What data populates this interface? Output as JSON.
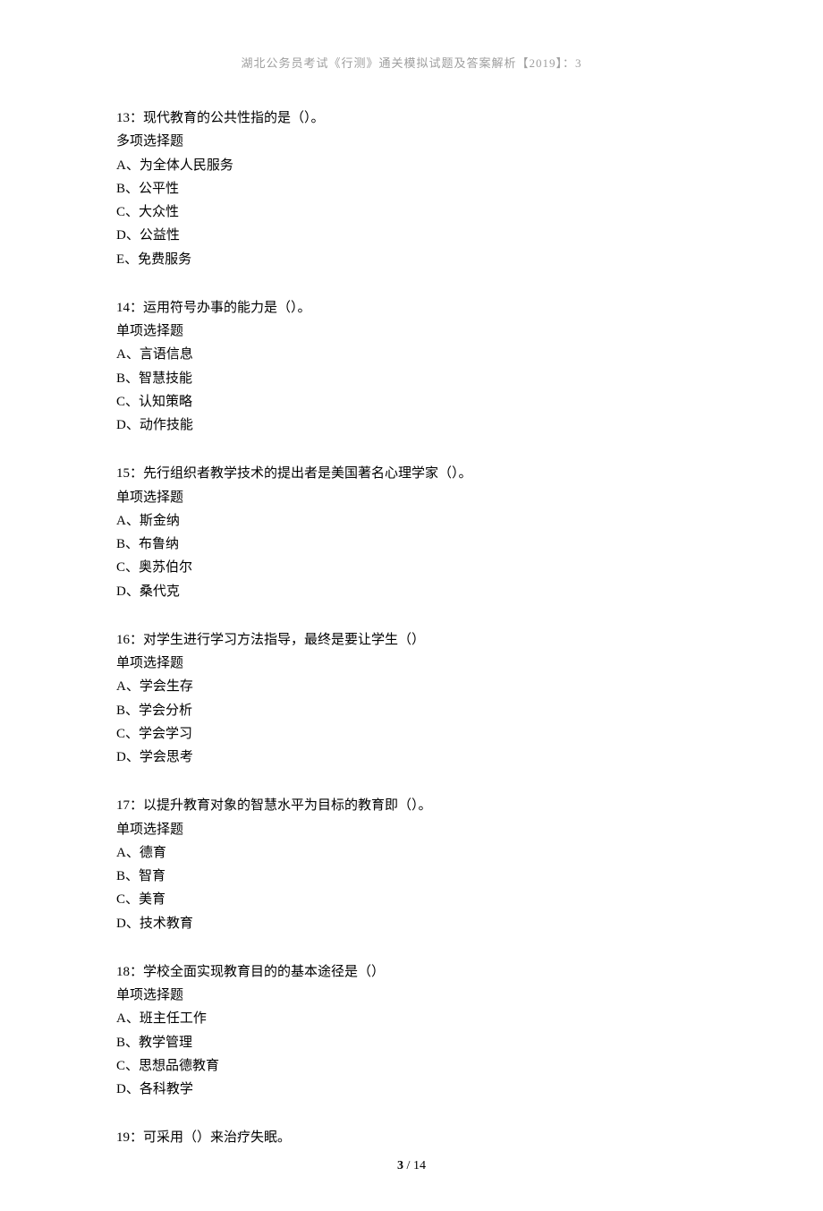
{
  "header": "湖北公务员考试《行测》通关模拟试题及答案解析【2019】：3",
  "questions": [
    {
      "num": "13",
      "text": "：现代教育的公共性指的是（）。",
      "type": "多项选择题",
      "options": [
        "A、为全体人民服务",
        "B、公平性",
        "C、大众性",
        "D、公益性",
        "E、免费服务"
      ]
    },
    {
      "num": "14",
      "text": "：运用符号办事的能力是（）。",
      "type": "单项选择题",
      "options": [
        "A、言语信息",
        "B、智慧技能",
        "C、认知策略",
        "D、动作技能"
      ]
    },
    {
      "num": "15",
      "text": "：先行组织者教学技术的提出者是美国著名心理学家（）。",
      "type": "单项选择题",
      "options": [
        "A、斯金纳",
        "B、布鲁纳",
        "C、奥苏伯尔",
        "D、桑代克"
      ]
    },
    {
      "num": "16",
      "text": "：对学生进行学习方法指导，最终是要让学生（）",
      "type": "单项选择题",
      "options": [
        "A、学会生存",
        "B、学会分析",
        "C、学会学习",
        "D、学会思考"
      ]
    },
    {
      "num": "17",
      "text": "：以提升教育对象的智慧水平为目标的教育即（）。",
      "type": "单项选择题",
      "options": [
        "A、德育",
        "B、智育",
        "C、美育",
        "D、技术教育"
      ]
    },
    {
      "num": "18",
      "text": "：学校全面实现教育目的的基本途径是（）",
      "type": "单项选择题",
      "options": [
        "A、班主任工作",
        "B、教学管理",
        "C、思想品德教育",
        "D、各科教学"
      ]
    },
    {
      "num": "19",
      "text": "：可采用（）来治疗失眠。",
      "type": "",
      "options": []
    }
  ],
  "footer": {
    "current": "3",
    "sep": " / ",
    "total": "14"
  }
}
